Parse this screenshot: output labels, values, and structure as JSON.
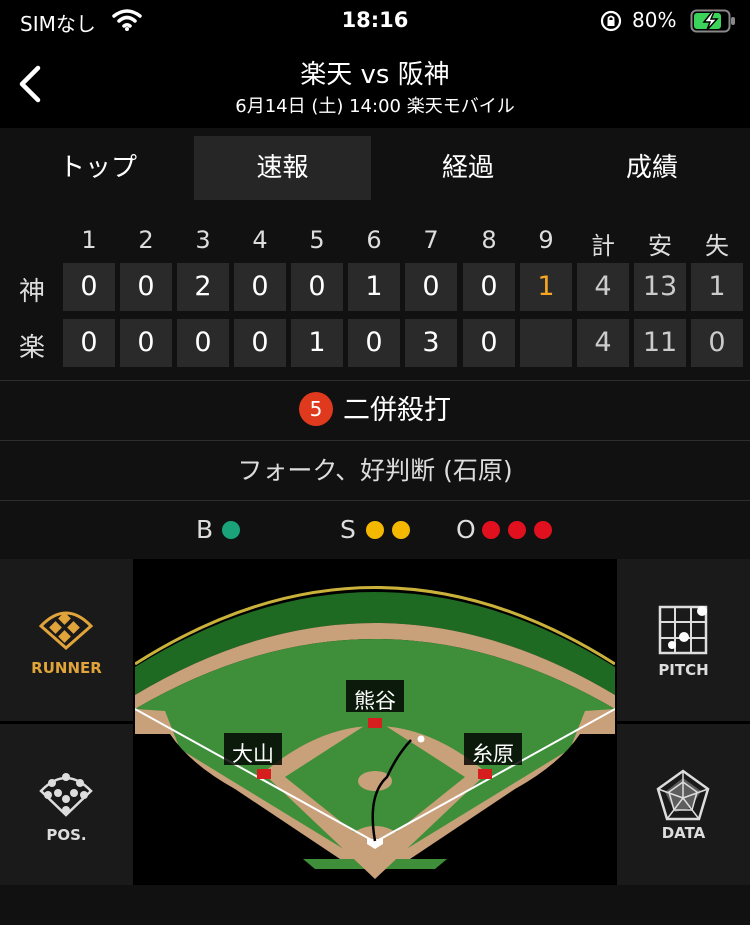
{
  "status": {
    "carrier": "SIMなし",
    "time": "18:16",
    "battery": "80%"
  },
  "nav": {
    "title": "楽天 vs 阪神",
    "subtitle": "6月14日 (土) 14:00 楽天モバイル"
  },
  "tabs": [
    {
      "label": "トップ",
      "active": false
    },
    {
      "label": "速報",
      "active": true
    },
    {
      "label": "経過",
      "active": false
    },
    {
      "label": "成績",
      "active": false
    }
  ],
  "scoreboard": {
    "headers": [
      "1",
      "2",
      "3",
      "4",
      "5",
      "6",
      "7",
      "8",
      "9",
      "計",
      "安",
      "失"
    ],
    "rows": [
      {
        "team": "神",
        "cells": [
          "0",
          "0",
          "2",
          "0",
          "0",
          "1",
          "0",
          "0",
          "1",
          "4",
          "13",
          "1"
        ]
      },
      {
        "team": "楽",
        "cells": [
          "0",
          "0",
          "0",
          "0",
          "1",
          "0",
          "3",
          "0",
          "",
          "4",
          "11",
          "0"
        ]
      }
    ]
  },
  "play": {
    "number": "5",
    "result": "二併殺打",
    "detail": "フォーク、好判断 (石原)"
  },
  "count": {
    "ball_label": "B",
    "strike_label": "S",
    "out_label": "O",
    "balls": 1,
    "strikes": 2,
    "outs": 3,
    "colors": {
      "ball": "#1aa37a",
      "strike": "#f5b800",
      "out": "#e0101e"
    }
  },
  "side_buttons": {
    "runner": "RUNNER",
    "pos": "POS.",
    "pitch": "PITCH",
    "data": "DATA"
  },
  "fielders": {
    "center": "熊谷",
    "left": "大山",
    "right": "糸原"
  },
  "colors": {
    "accent": "#e0a43a",
    "grass": "#3f8f3a",
    "dirt": "#c8a07a"
  }
}
